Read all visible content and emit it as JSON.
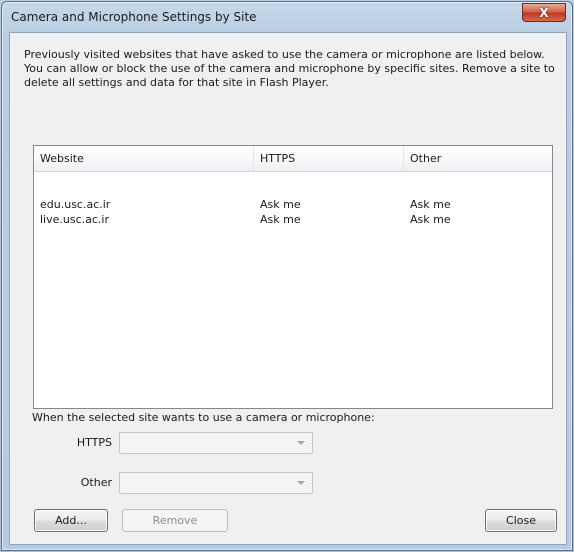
{
  "window": {
    "title": "Camera and Microphone Settings by Site",
    "close_glyph": "X"
  },
  "intro_text": "Previously visited websites that have asked to use the camera or microphone are listed below. You can allow or block the use of the camera and microphone by specific sites. Remove a site to delete all settings and data for that site in Flash Player.",
  "table": {
    "columns": [
      "Website",
      "HTTPS",
      "Other"
    ],
    "rows": [
      [
        "edu.usc.ac.ir",
        "Ask me",
        "Ask me"
      ],
      [
        "live.usc.ac.ir",
        "Ask me",
        "Ask me"
      ]
    ]
  },
  "settings": {
    "prompt": "When the selected site wants to use a camera or microphone:",
    "https_label": "HTTPS",
    "https_value": "",
    "other_label": "Other",
    "other_value": ""
  },
  "buttons": {
    "add": "Add...",
    "remove": "Remove",
    "close": "Close"
  }
}
